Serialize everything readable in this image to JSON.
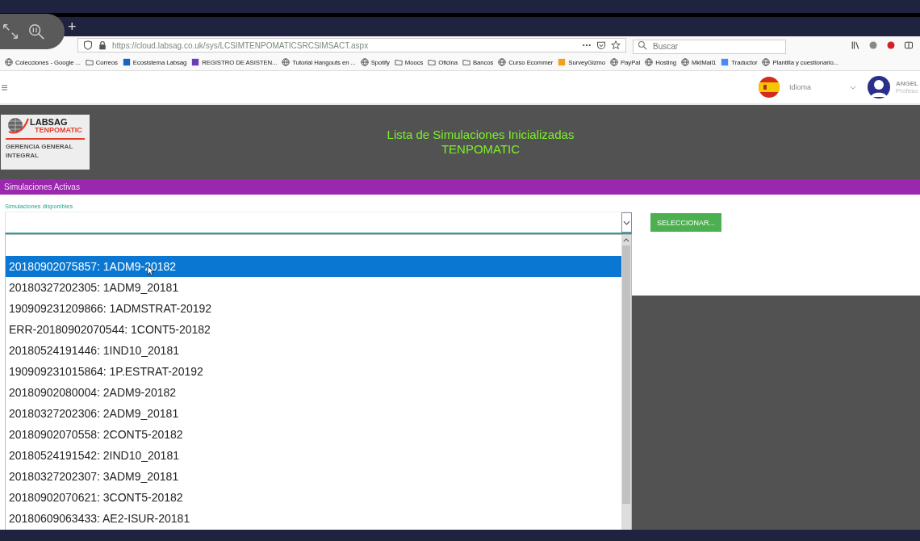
{
  "browser": {
    "new_tab": "+",
    "url": "https://cloud.labsag.co.uk/sys/LCSIMTENPOMATICSRCSIMSACT.aspx",
    "search": {
      "placeholder": "Buscar"
    },
    "bookmarks": [
      {
        "label": "Colecciones - Google ...",
        "kind": "globe"
      },
      {
        "label": "Correos",
        "kind": "folder"
      },
      {
        "label": "Ecosistema Labsag",
        "kind": "square",
        "color": "#1565c0"
      },
      {
        "label": "REGISTRO DE ASISTEN...",
        "kind": "square",
        "color": "#6a3fb5"
      },
      {
        "label": "Tutorial Hangouts en ...",
        "kind": "globe"
      },
      {
        "label": "Spotify",
        "kind": "globe"
      },
      {
        "label": "Moocs",
        "kind": "folder"
      },
      {
        "label": "Oficina",
        "kind": "folder"
      },
      {
        "label": "Bancos",
        "kind": "folder"
      },
      {
        "label": "Curso Ecommer",
        "kind": "globe"
      },
      {
        "label": "SurveyGizmo",
        "kind": "square",
        "color": "#f0a020"
      },
      {
        "label": "PayPal",
        "kind": "globe"
      },
      {
        "label": "Hosting",
        "kind": "globe"
      },
      {
        "label": "MktMail1",
        "kind": "globe"
      },
      {
        "label": "Traductor",
        "kind": "square",
        "color": "#4a8af4"
      },
      {
        "label": "Plantilla y cuestionario...",
        "kind": "globe"
      }
    ]
  },
  "topbar": {
    "language": "Idioma",
    "user_name": "ANGEL",
    "user_role": "Profeso"
  },
  "header": {
    "logo_brand": "LABSAG",
    "logo_product": "TENPOMATIC",
    "logo_caption": "GERENCIA GENERAL INTEGRAL",
    "title": "Lista de Simulaciones Inicializadas",
    "subtitle": "TENPOMATIC"
  },
  "section_bar": "Simulaciones Activas",
  "form": {
    "field_label": "Simulaciones disponibles",
    "button": "SELECCIONAR...",
    "options": [
      {
        "label": "20180902075857: 1ADM9-20182",
        "selected": true
      },
      {
        "label": "20180327202305: 1ADM9_20181",
        "selected": false
      },
      {
        "label": "190909231209866: 1ADMSTRAT-20192",
        "selected": false
      },
      {
        "label": "ERR-20180902070544: 1CONT5-20182",
        "selected": false
      },
      {
        "label": "20180524191446: 1IND10_20181",
        "selected": false
      },
      {
        "label": "190909231015864: 1P.ESTRAT-20192",
        "selected": false
      },
      {
        "label": "20180902080004: 2ADM9-20182",
        "selected": false
      },
      {
        "label": "20180327202306: 2ADM9_20181",
        "selected": false
      },
      {
        "label": "20180902070558: 2CONT5-20182",
        "selected": false
      },
      {
        "label": "20180524191542: 2IND10_20181",
        "selected": false
      },
      {
        "label": "20180327202307: 3ADM9_20181",
        "selected": false
      },
      {
        "label": "20180902070621: 3CONT5-20182",
        "selected": false
      },
      {
        "label": "20180609063433: AE2-ISUR-20181",
        "selected": false
      }
    ]
  }
}
